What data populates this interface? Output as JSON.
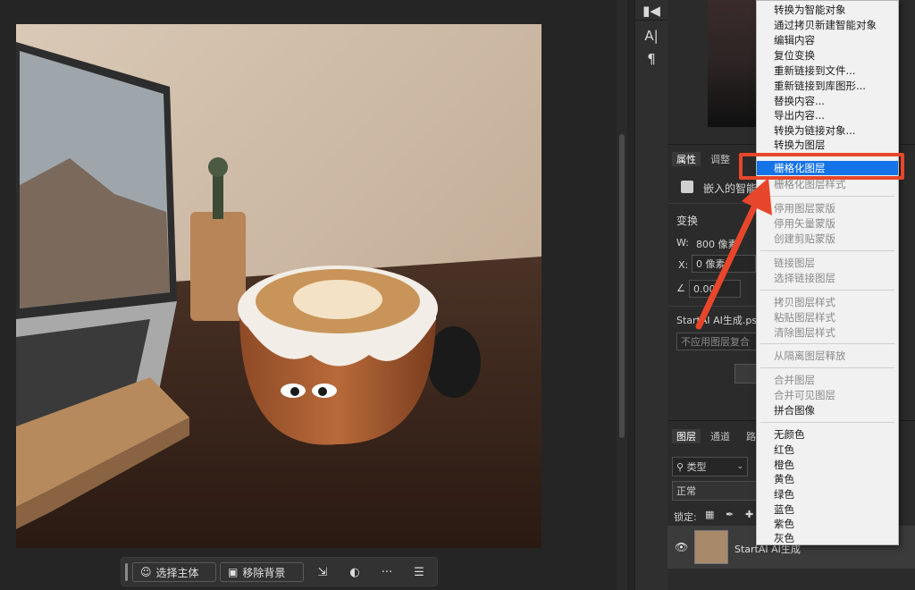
{
  "taskbar": {
    "select_subject": "选择主体",
    "remove_background": "移除背景",
    "more": "···"
  },
  "tools": {
    "text_tool": "A|",
    "paragraph_tool": "¶"
  },
  "properties": {
    "tabs": [
      "属性",
      "调整"
    ],
    "layer_type": "嵌入的智能",
    "section_title": "变换",
    "w_label": "W:",
    "w_value": "800 像素",
    "x_label": "X:",
    "x_value": "0 像素",
    "angle_value": "0.00°",
    "file_name": "StartAI AI生成.ps",
    "comp_placeholder": "不应用图层复合"
  },
  "layers": {
    "tabs": [
      "图层",
      "通道",
      "路"
    ],
    "filter_kind": "类型",
    "blend_mode": "正常",
    "lock_label": "锁定:",
    "layer_name": "StartAI AI生成"
  },
  "menu": {
    "items": [
      {
        "label": "转换为智能对象",
        "disabled": false
      },
      {
        "label": "通过拷贝新建智能对象",
        "disabled": false
      },
      {
        "label": "编辑内容",
        "disabled": false
      },
      {
        "label": "复位变换",
        "disabled": false
      },
      {
        "label": "重新链接到文件...",
        "disabled": false
      },
      {
        "label": "重新链接到库图形...",
        "disabled": false
      },
      {
        "label": "替换内容...",
        "disabled": false
      },
      {
        "label": "导出内容...",
        "disabled": false
      },
      {
        "label": "转换为链接对象...",
        "disabled": false
      },
      {
        "label": "转换为图层",
        "disabled": false
      }
    ],
    "highlighted": "栅格化图层",
    "group2": [
      {
        "label": "栅格化图层样式",
        "disabled": true
      }
    ],
    "group3": [
      {
        "label": "停用图层蒙版",
        "disabled": true
      },
      {
        "label": "停用矢量蒙版",
        "disabled": true
      },
      {
        "label": "创建剪贴蒙版",
        "disabled": true
      }
    ],
    "group4": [
      {
        "label": "链接图层",
        "disabled": true
      },
      {
        "label": "选择链接图层",
        "disabled": true
      }
    ],
    "group5": [
      {
        "label": "拷贝图层样式",
        "disabled": true
      },
      {
        "label": "粘贴图层样式",
        "disabled": true
      },
      {
        "label": "清除图层样式",
        "disabled": true
      }
    ],
    "group6": [
      {
        "label": "从隔离图层释放",
        "disabled": true
      }
    ],
    "group7": [
      {
        "label": "合并图层",
        "disabled": true
      },
      {
        "label": "合并可见图层",
        "disabled": true
      },
      {
        "label": "拼合图像",
        "disabled": false
      }
    ],
    "colors": [
      {
        "label": "无颜色"
      },
      {
        "label": "红色"
      },
      {
        "label": "橙色"
      },
      {
        "label": "黄色"
      },
      {
        "label": "绿色"
      },
      {
        "label": "蓝色"
      },
      {
        "label": "紫色"
      },
      {
        "label": "灰色"
      }
    ]
  },
  "colors": {
    "highlight": "#1473e6",
    "annotation": "#e8462b"
  }
}
